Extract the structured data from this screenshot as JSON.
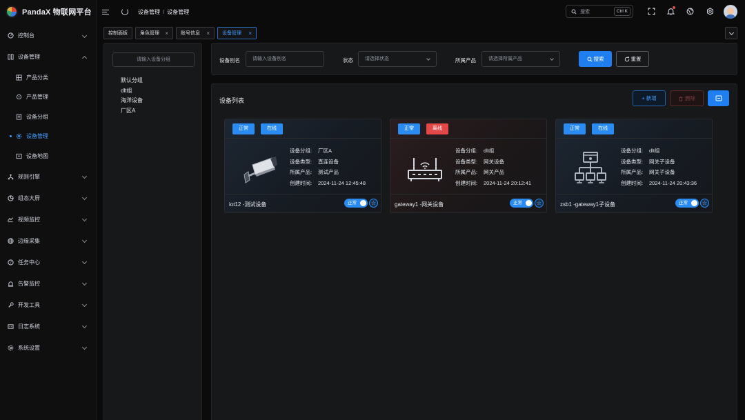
{
  "app": {
    "title": "PandaX 物联网平台"
  },
  "sidebar": {
    "items": [
      {
        "label": "控制台",
        "icon": "dashboard-icon"
      },
      {
        "label": "设备管理",
        "icon": "device-manage-icon",
        "expanded": true
      },
      {
        "label": "产品分类",
        "icon": "category-icon"
      },
      {
        "label": "产品管理",
        "icon": "product-icon"
      },
      {
        "label": "设备分组",
        "icon": "group-icon"
      },
      {
        "label": "设备管理",
        "icon": "device-gear-icon",
        "active": true
      },
      {
        "label": "设备地图",
        "icon": "map-icon"
      },
      {
        "label": "规则引擎",
        "icon": "rule-engine-icon"
      },
      {
        "label": "组态大屏",
        "icon": "screen-icon"
      },
      {
        "label": "视频监控",
        "icon": "video-icon"
      },
      {
        "label": "边缘采集",
        "icon": "edge-icon"
      },
      {
        "label": "任务中心",
        "icon": "task-icon"
      },
      {
        "label": "告警监控",
        "icon": "alarm-icon"
      },
      {
        "label": "开发工具",
        "icon": "tool-icon"
      },
      {
        "label": "日志系统",
        "icon": "log-icon"
      },
      {
        "label": "系统设置",
        "icon": "settings-icon"
      }
    ]
  },
  "topbar": {
    "breadcrumb": [
      "设备管理",
      "设备管理"
    ],
    "search": {
      "placeholder": "搜索",
      "shortcut": "Ctrl K"
    }
  },
  "tags": [
    {
      "label": "控制面板",
      "closable": false
    },
    {
      "label": "角色管理",
      "closable": true
    },
    {
      "label": "账号信息",
      "closable": true
    },
    {
      "label": "设备管理",
      "closable": true,
      "active": true
    }
  ],
  "groups": {
    "placeholder": "请输入设备分组",
    "items": [
      "默认分组",
      "dlt组",
      "海洋设备",
      "厂区A"
    ]
  },
  "filter": {
    "alias_label": "设备别名",
    "alias_placeholder": "请输入设备别名",
    "status_label": "状态",
    "status_placeholder": "请选择状态",
    "product_label": "所属产品",
    "product_placeholder": "请选择所属产品",
    "search_label": "搜索",
    "reset_label": "重置"
  },
  "list": {
    "title": "设备列表",
    "add_label": "+ 新增",
    "delete_label": "删除",
    "keys": {
      "group": "设备分组:",
      "type": "设备类型:",
      "product": "所属产品:",
      "created": "创建时间:"
    },
    "devices": [
      {
        "chip1": "正常",
        "chip2": "在线",
        "group": "厂区A",
        "type": "直连设备",
        "product": "测试产品",
        "created": "2024-11-24 12:45:48",
        "name": "iot12 -测试设备",
        "switch": "正常",
        "icon": "camera-icon",
        "theme_color": "#2a8cf2"
      },
      {
        "chip1": "正常",
        "chip2": "离线",
        "group": "dlt组",
        "type": "网关设备",
        "product": "网关产品",
        "created": "2024-11-24 20:12:41",
        "name": "gateway1 -网关设备",
        "switch": "正常",
        "icon": "router-icon",
        "theme_color": "#e24848"
      },
      {
        "chip1": "正常",
        "chip2": "在线",
        "group": "dlt组",
        "type": "网关子设备",
        "product": "网关子设备",
        "created": "2024-11-24 20:43:36",
        "name": "zsb1 -gateway1子设备",
        "switch": "正常",
        "icon": "network-topology-icon",
        "theme_color": "#2a8cf2"
      }
    ]
  }
}
